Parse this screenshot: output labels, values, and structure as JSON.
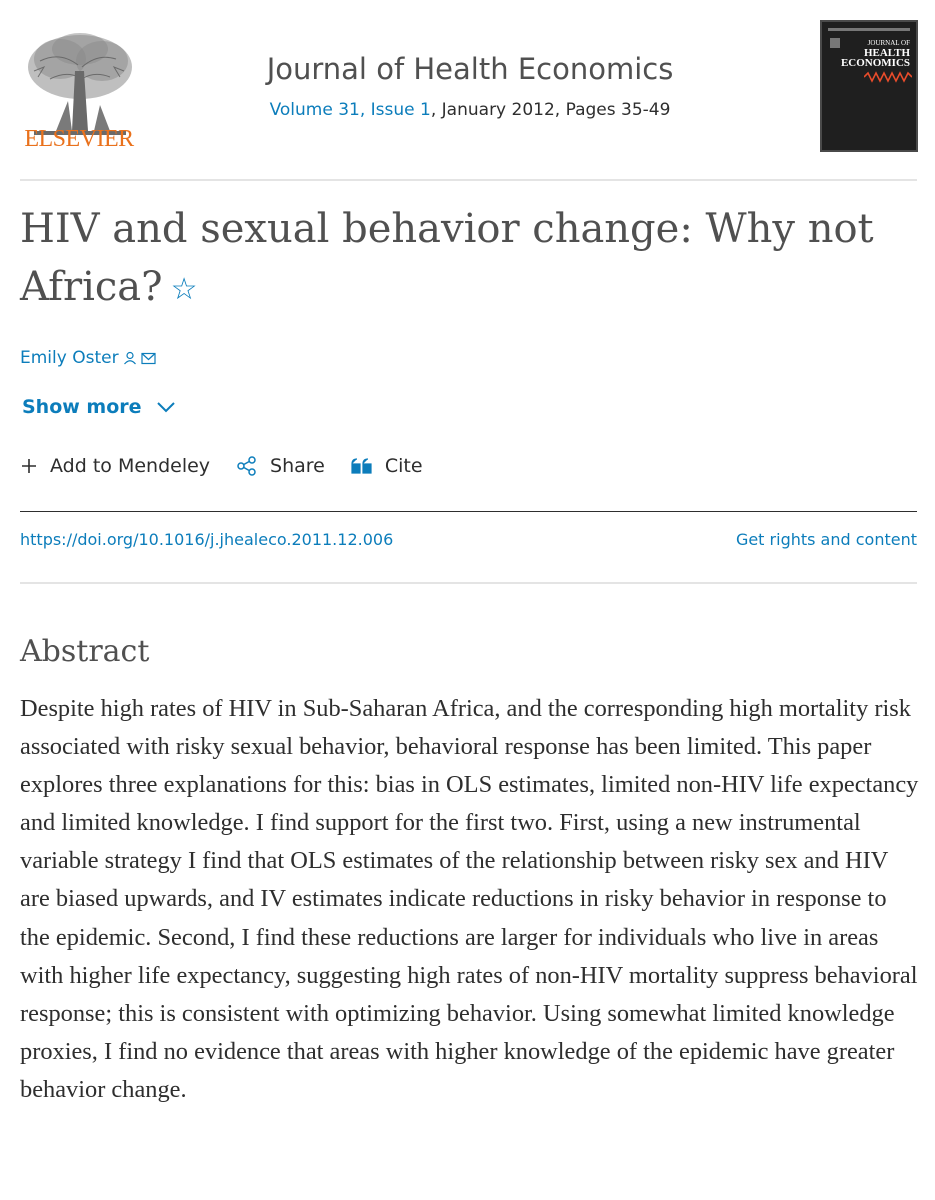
{
  "publisher": {
    "name": "ELSEVIER"
  },
  "journal": {
    "title": "Journal of Health Economics",
    "volume_issue": "Volume 31, Issue 1",
    "date_pages": ", January 2012, Pages 35-49",
    "cover": {
      "line1": "JOURNAL OF",
      "line2": "HEALTH",
      "line3": "ECONOMICS"
    }
  },
  "article": {
    "title": "HIV and sexual behavior change: Why not Africa?",
    "star": "☆",
    "author": "Emily Oster",
    "show_more": "Show more",
    "doi": "https://doi.org/10.1016/j.jhealeco.2011.12.006",
    "rights": "Get rights and content"
  },
  "actions": {
    "mendeley": "Add to Mendeley",
    "share": "Share",
    "cite": "Cite"
  },
  "abstract": {
    "heading": "Abstract",
    "text": "Despite high rates of HIV in Sub-Saharan Africa, and the corresponding high mortality risk associated with risky sexual behavior, behavioral response has been limited. This paper explores three explanations for this: bias in OLS estimates, limited non-HIV life expectancy and limited knowledge. I find support for the first two. First, using a new instrumental variable strategy I find that OLS estimates of the relationship between risky sex and HIV are biased upwards, and IV estimates indicate reductions in risky behavior in response to the epidemic. Second, I find these reductions are larger for individuals who live in areas with higher life expectancy, suggesting high rates of non-HIV mortality suppress behavioral response; this is consistent with optimizing behavior. Using somewhat limited knowledge proxies, I find no evidence that areas with higher knowledge of the epidemic have greater behavior change."
  },
  "colors": {
    "link": "#0c7dbb",
    "brand": "#e9711c",
    "text": "#2e2e2e"
  }
}
